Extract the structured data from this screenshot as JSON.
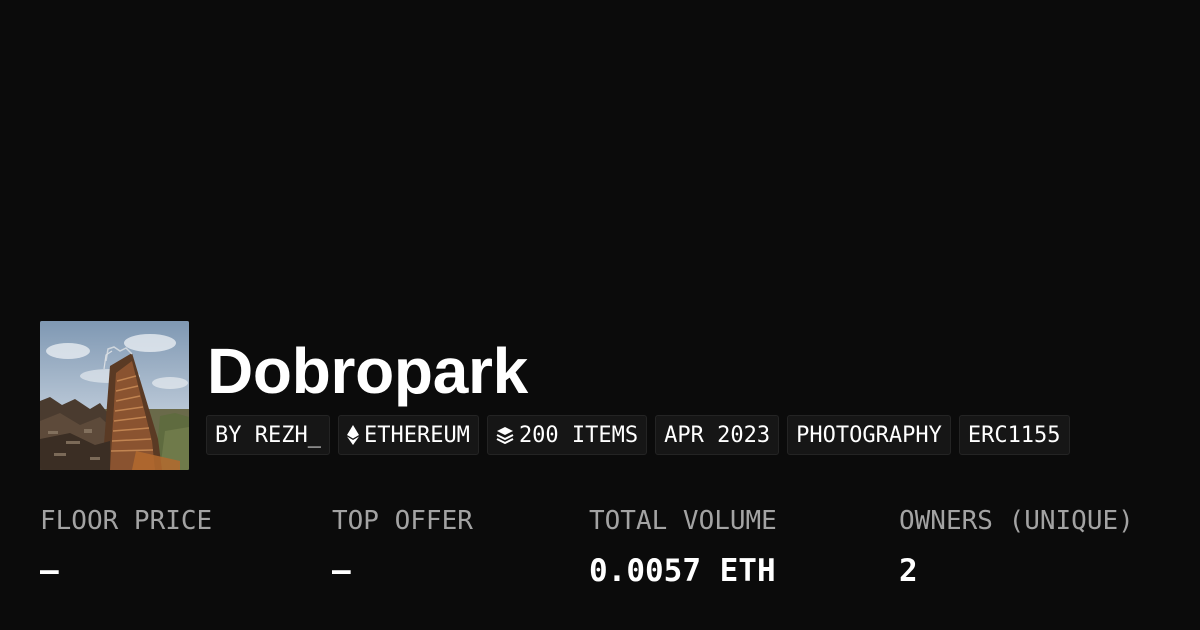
{
  "collection": {
    "name": "Dobropark",
    "avatar_alt": "collection-thumbnail"
  },
  "tags": [
    {
      "label": "BY REZH_",
      "icon": ""
    },
    {
      "label": "ETHEREUM",
      "icon": "ethereum-icon"
    },
    {
      "label": "200 ITEMS",
      "icon": "layers-icon"
    },
    {
      "label": "APR 2023",
      "icon": ""
    },
    {
      "label": "PHOTOGRAPHY",
      "icon": ""
    },
    {
      "label": "ERC1155",
      "icon": ""
    }
  ],
  "stats": [
    {
      "label": "FLOOR PRICE",
      "value": "—"
    },
    {
      "label": "TOP OFFER",
      "value": "—"
    },
    {
      "label": "TOTAL VOLUME",
      "value": "0.0057 ETH"
    },
    {
      "label": "OWNERS (UNIQUE)",
      "value": "2"
    }
  ],
  "colors": {
    "background": "#0b0b0b",
    "text": "#ffffff",
    "label": "#a3a3a3",
    "tag_background": "#161616"
  }
}
